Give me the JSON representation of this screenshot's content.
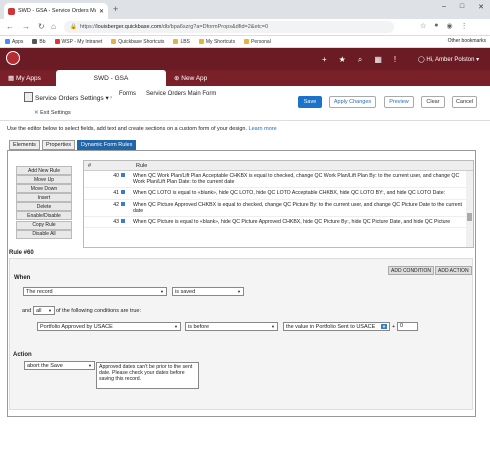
{
  "browser": {
    "tab_title": "SWD - GSA - Service Orders Main",
    "new_tab": "+",
    "url_domain": "louisberger.quickbase.com",
    "url_path": "/db/bpa6szrg?a=DformProps&dfid=2&etc=0",
    "url_prefix": "https://",
    "bookmarks": [
      "Apps",
      "Bb",
      "WSP - My Intranet",
      "Quickbase Shortcuts",
      "LBS",
      "My Shortcuts",
      "Personal"
    ],
    "other_bookmarks": "Other bookmarks",
    "window_controls": [
      "–",
      "□",
      "✕"
    ]
  },
  "app": {
    "my_apps": "My Apps",
    "app_tab": "SWD - GSA",
    "new_app": "New App",
    "user": "Hi, Amber Polston"
  },
  "page": {
    "breadcrumb_table": "Service Orders Settings",
    "breadcrumb_forms": "Forms",
    "breadcrumb_form": "Service Orders Main Form",
    "exit": "Exit Settings",
    "buttons": {
      "save": "Save",
      "apply": "Apply Changes",
      "preview": "Preview",
      "clear": "Clear",
      "cancel": "Cancel"
    },
    "intro": "Use the editor below to select fields, add text and create sections on a custom form of your design.",
    "learn_more": "Learn more"
  },
  "tabs": [
    "Elements",
    "Properties",
    "Dynamic Form Rules"
  ],
  "rule_buttons": [
    "Add New Rule",
    "Move Up",
    "Move Down",
    "Insert",
    "Delete",
    "Enable/Disable",
    "Copy Rule",
    "Disable All"
  ],
  "table": {
    "col_num": "#",
    "col_rule": "Rule",
    "rows": [
      {
        "num": "40",
        "text": "When QC Work Plan/Lift Plan Acceptable CHKBX is equal to checked, change QC Work Plan/Lift Plan By: to the current user, and change QC Work Plan/Lift Plan Date: to the current date"
      },
      {
        "num": "41",
        "text": "When QC LOTO is equal to «blank», hide QC LOTO, hide QC LOTO Acceptable CHKBX, hide QC LOTO BY:, and hide QC LOTO Date:"
      },
      {
        "num": "42",
        "text": "When QC Picture Approved CHKBX is equal to checked, change QC Picture By: to the current user, and change QC Picture Date to the current date"
      },
      {
        "num": "43",
        "text": "When QC Picture is equal to «blank», hide QC Picture Approved CHKBX, hide QC Picture By:, hide QC Picture Date, and hide QC Picture"
      }
    ]
  },
  "rule": {
    "title": "Rule #60",
    "add_condition": "ADD CONDITION",
    "add_action": "ADD ACTION",
    "when_label": "When",
    "record": "The record",
    "saved": "is saved",
    "and": "and",
    "all": "all",
    "cond_text": "of the following conditions are true:",
    "field": "Portfolio Approved by USACE",
    "operator": "is before",
    "value": "the value in Portfolio Sent to USACE",
    "plus": "+",
    "number": "0",
    "action_label": "Action",
    "action": "abort the Save",
    "message": "Approved dates can't be prior to the sent date.  Please check your dates before saving this record."
  }
}
